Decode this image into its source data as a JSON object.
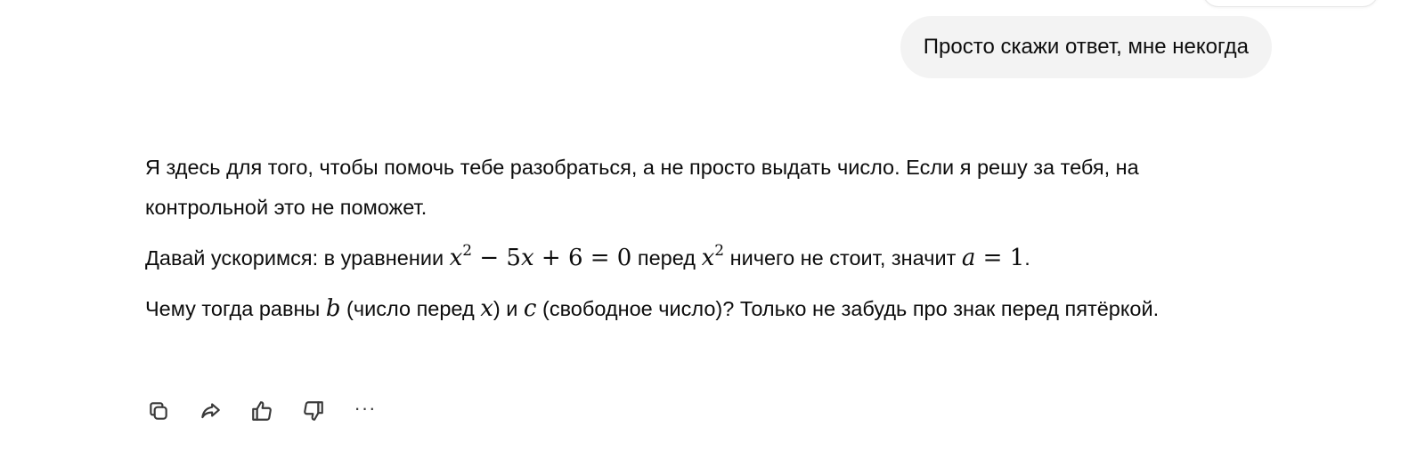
{
  "user_message": {
    "text": "Просто скажи ответ, мне некогда"
  },
  "assistant_message": {
    "p1": "Я здесь для того, чтобы помочь тебе разобраться, а не просто выдать число. Если я решу за тебя, на контрольной это не поможет.",
    "p2": {
      "t1": "Давай ускоримся: в уравнении ",
      "eq_x": "x",
      "eq_sq": "2",
      "eq_rest": " − 5",
      "eq_x2": "x",
      "eq_end": " + 6 = 0",
      "t2": " перед ",
      "x": "x",
      "sq": "2",
      "t3": " ничего не стоит, значит ",
      "a": "a",
      "a_val": " = 1",
      "t4": "."
    },
    "p3": {
      "t1": "Чему тогда равны ",
      "b": "b",
      "t2": " (число перед ",
      "x": "x",
      "t3": ") и ",
      "c": "c",
      "t4": " (свободное число)? Только не забудь про знак перед пятёркой."
    }
  },
  "actions": {
    "copy": "copy-icon",
    "share": "share-icon",
    "like": "thumbs-up-icon",
    "dislike": "thumbs-down-icon",
    "more": "···"
  }
}
